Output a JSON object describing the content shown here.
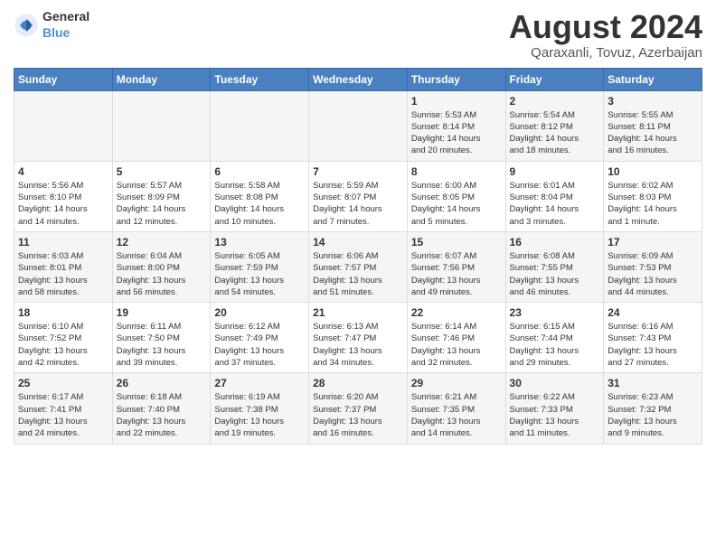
{
  "header": {
    "logo_general": "General",
    "logo_blue": "Blue",
    "title": "August 2024",
    "subtitle": "Qaraxanli, Tovuz, Azerbaijan"
  },
  "days_of_week": [
    "Sunday",
    "Monday",
    "Tuesday",
    "Wednesday",
    "Thursday",
    "Friday",
    "Saturday"
  ],
  "weeks": [
    [
      {
        "day": "",
        "info": ""
      },
      {
        "day": "",
        "info": ""
      },
      {
        "day": "",
        "info": ""
      },
      {
        "day": "",
        "info": ""
      },
      {
        "day": "1",
        "info": "Sunrise: 5:53 AM\nSunset: 8:14 PM\nDaylight: 14 hours\nand 20 minutes."
      },
      {
        "day": "2",
        "info": "Sunrise: 5:54 AM\nSunset: 8:12 PM\nDaylight: 14 hours\nand 18 minutes."
      },
      {
        "day": "3",
        "info": "Sunrise: 5:55 AM\nSunset: 8:11 PM\nDaylight: 14 hours\nand 16 minutes."
      }
    ],
    [
      {
        "day": "4",
        "info": "Sunrise: 5:56 AM\nSunset: 8:10 PM\nDaylight: 14 hours\nand 14 minutes."
      },
      {
        "day": "5",
        "info": "Sunrise: 5:57 AM\nSunset: 8:09 PM\nDaylight: 14 hours\nand 12 minutes."
      },
      {
        "day": "6",
        "info": "Sunrise: 5:58 AM\nSunset: 8:08 PM\nDaylight: 14 hours\nand 10 minutes."
      },
      {
        "day": "7",
        "info": "Sunrise: 5:59 AM\nSunset: 8:07 PM\nDaylight: 14 hours\nand 7 minutes."
      },
      {
        "day": "8",
        "info": "Sunrise: 6:00 AM\nSunset: 8:05 PM\nDaylight: 14 hours\nand 5 minutes."
      },
      {
        "day": "9",
        "info": "Sunrise: 6:01 AM\nSunset: 8:04 PM\nDaylight: 14 hours\nand 3 minutes."
      },
      {
        "day": "10",
        "info": "Sunrise: 6:02 AM\nSunset: 8:03 PM\nDaylight: 14 hours\nand 1 minute."
      }
    ],
    [
      {
        "day": "11",
        "info": "Sunrise: 6:03 AM\nSunset: 8:01 PM\nDaylight: 13 hours\nand 58 minutes."
      },
      {
        "day": "12",
        "info": "Sunrise: 6:04 AM\nSunset: 8:00 PM\nDaylight: 13 hours\nand 56 minutes."
      },
      {
        "day": "13",
        "info": "Sunrise: 6:05 AM\nSunset: 7:59 PM\nDaylight: 13 hours\nand 54 minutes."
      },
      {
        "day": "14",
        "info": "Sunrise: 6:06 AM\nSunset: 7:57 PM\nDaylight: 13 hours\nand 51 minutes."
      },
      {
        "day": "15",
        "info": "Sunrise: 6:07 AM\nSunset: 7:56 PM\nDaylight: 13 hours\nand 49 minutes."
      },
      {
        "day": "16",
        "info": "Sunrise: 6:08 AM\nSunset: 7:55 PM\nDaylight: 13 hours\nand 46 minutes."
      },
      {
        "day": "17",
        "info": "Sunrise: 6:09 AM\nSunset: 7:53 PM\nDaylight: 13 hours\nand 44 minutes."
      }
    ],
    [
      {
        "day": "18",
        "info": "Sunrise: 6:10 AM\nSunset: 7:52 PM\nDaylight: 13 hours\nand 42 minutes."
      },
      {
        "day": "19",
        "info": "Sunrise: 6:11 AM\nSunset: 7:50 PM\nDaylight: 13 hours\nand 39 minutes."
      },
      {
        "day": "20",
        "info": "Sunrise: 6:12 AM\nSunset: 7:49 PM\nDaylight: 13 hours\nand 37 minutes."
      },
      {
        "day": "21",
        "info": "Sunrise: 6:13 AM\nSunset: 7:47 PM\nDaylight: 13 hours\nand 34 minutes."
      },
      {
        "day": "22",
        "info": "Sunrise: 6:14 AM\nSunset: 7:46 PM\nDaylight: 13 hours\nand 32 minutes."
      },
      {
        "day": "23",
        "info": "Sunrise: 6:15 AM\nSunset: 7:44 PM\nDaylight: 13 hours\nand 29 minutes."
      },
      {
        "day": "24",
        "info": "Sunrise: 6:16 AM\nSunset: 7:43 PM\nDaylight: 13 hours\nand 27 minutes."
      }
    ],
    [
      {
        "day": "25",
        "info": "Sunrise: 6:17 AM\nSunset: 7:41 PM\nDaylight: 13 hours\nand 24 minutes."
      },
      {
        "day": "26",
        "info": "Sunrise: 6:18 AM\nSunset: 7:40 PM\nDaylight: 13 hours\nand 22 minutes."
      },
      {
        "day": "27",
        "info": "Sunrise: 6:19 AM\nSunset: 7:38 PM\nDaylight: 13 hours\nand 19 minutes."
      },
      {
        "day": "28",
        "info": "Sunrise: 6:20 AM\nSunset: 7:37 PM\nDaylight: 13 hours\nand 16 minutes."
      },
      {
        "day": "29",
        "info": "Sunrise: 6:21 AM\nSunset: 7:35 PM\nDaylight: 13 hours\nand 14 minutes."
      },
      {
        "day": "30",
        "info": "Sunrise: 6:22 AM\nSunset: 7:33 PM\nDaylight: 13 hours\nand 11 minutes."
      },
      {
        "day": "31",
        "info": "Sunrise: 6:23 AM\nSunset: 7:32 PM\nDaylight: 13 hours\nand 9 minutes."
      }
    ]
  ]
}
